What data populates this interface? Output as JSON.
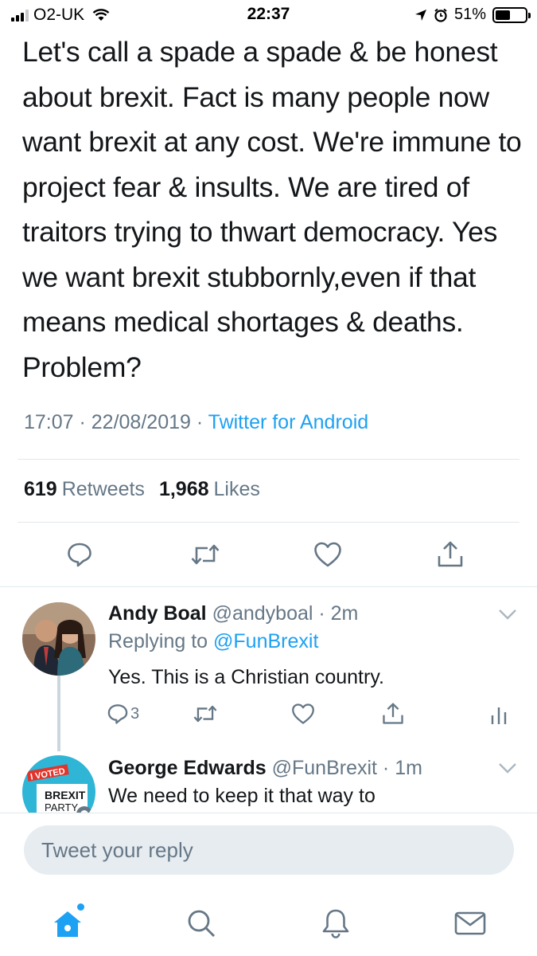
{
  "status_bar": {
    "carrier": "O2-UK",
    "time": "22:37",
    "battery": "51%",
    "battery_level": 0.51
  },
  "tweet": {
    "text": "Let's call a spade a spade & be honest about brexit. Fact is many people now want brexit at any cost. We're immune to project fear & insults. We are tired of traitors trying to thwart democracy. Yes we want brexit stubbornly,even if that means medical shortages & deaths. Problem?",
    "timestamp": "17:07 · 22/08/2019 · ",
    "source": "Twitter for Android",
    "retweet_count": "619",
    "retweet_label": "Retweets",
    "like_count": "1,968",
    "like_label": "Likes"
  },
  "replies": [
    {
      "name": "Andy Boal",
      "handle": "@andyboal · 2m",
      "replying_prefix": "Replying to ",
      "replying_to": "@FunBrexit",
      "text": "Yes. This is a Christian country.",
      "reply_count": "3"
    },
    {
      "name": "George Edwards",
      "handle": "@FunBrexit · 1m",
      "text": "We need to keep it that way to",
      "avatar_badge_top": "I VOTED",
      "avatar_badge_mid": "BREXIT",
      "avatar_badge_bot": "PARTY"
    }
  ],
  "compose": {
    "placeholder": "Tweet your reply"
  },
  "colors": {
    "accent": "#1da1f2",
    "text": "#14171a",
    "muted": "#657786",
    "divider": "#e1e8ed"
  },
  "icons": [
    "reply-icon",
    "retweet-icon",
    "like-icon",
    "share-icon",
    "analytics-icon",
    "chevron-down-icon",
    "home-icon",
    "search-icon",
    "notifications-icon",
    "messages-icon"
  ]
}
